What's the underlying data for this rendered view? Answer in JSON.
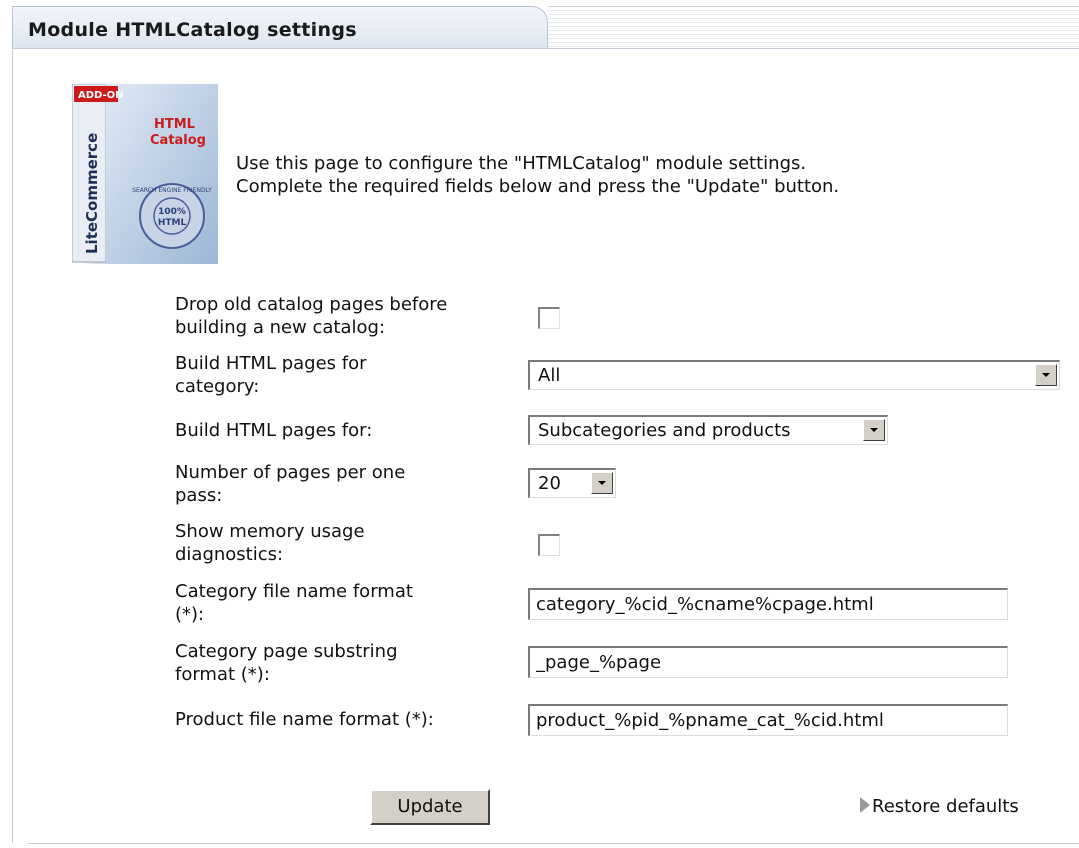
{
  "header": {
    "title": "Module HTMLCatalog settings"
  },
  "intro": {
    "line1": "Use this page to configure the \"HTMLCatalog\" module settings.",
    "line2": "Complete the required fields below and press the \"Update\" button."
  },
  "product_box": {
    "addon": "ADD-ON",
    "brand": "LiteCommerce",
    "title1": "HTML",
    "title2": "Catalog",
    "seal_top": "SEARCH ENGINE FRIENDLY",
    "seal_mid": "100%",
    "seal_low": "HTML"
  },
  "fields": {
    "drop_old": {
      "label1": "Drop old catalog pages before",
      "label2": "building a new catalog:",
      "checked": false
    },
    "category": {
      "label1": "Build HTML pages for",
      "label2": "category:",
      "value": "All"
    },
    "build_for": {
      "label": "Build HTML pages for:",
      "value": "Subcategories and products"
    },
    "pages_per_pass": {
      "label1": "Number of pages per one",
      "label2": "pass:",
      "value": "20"
    },
    "memory": {
      "label1": "Show memory usage",
      "label2": "diagnostics:",
      "checked": false
    },
    "cat_file": {
      "label1": "Category file name format",
      "label2": "(*):",
      "value": "category_%cid_%cname%cpage.html"
    },
    "cat_page": {
      "label1": "Category page substring",
      "label2": "format (*):",
      "value": "_page_%page"
    },
    "prod_file": {
      "label": "Product file name format (*):",
      "value": "product_%pid_%pname_cat_%cid.html"
    }
  },
  "actions": {
    "update": "Update",
    "restore": "Restore defaults"
  }
}
